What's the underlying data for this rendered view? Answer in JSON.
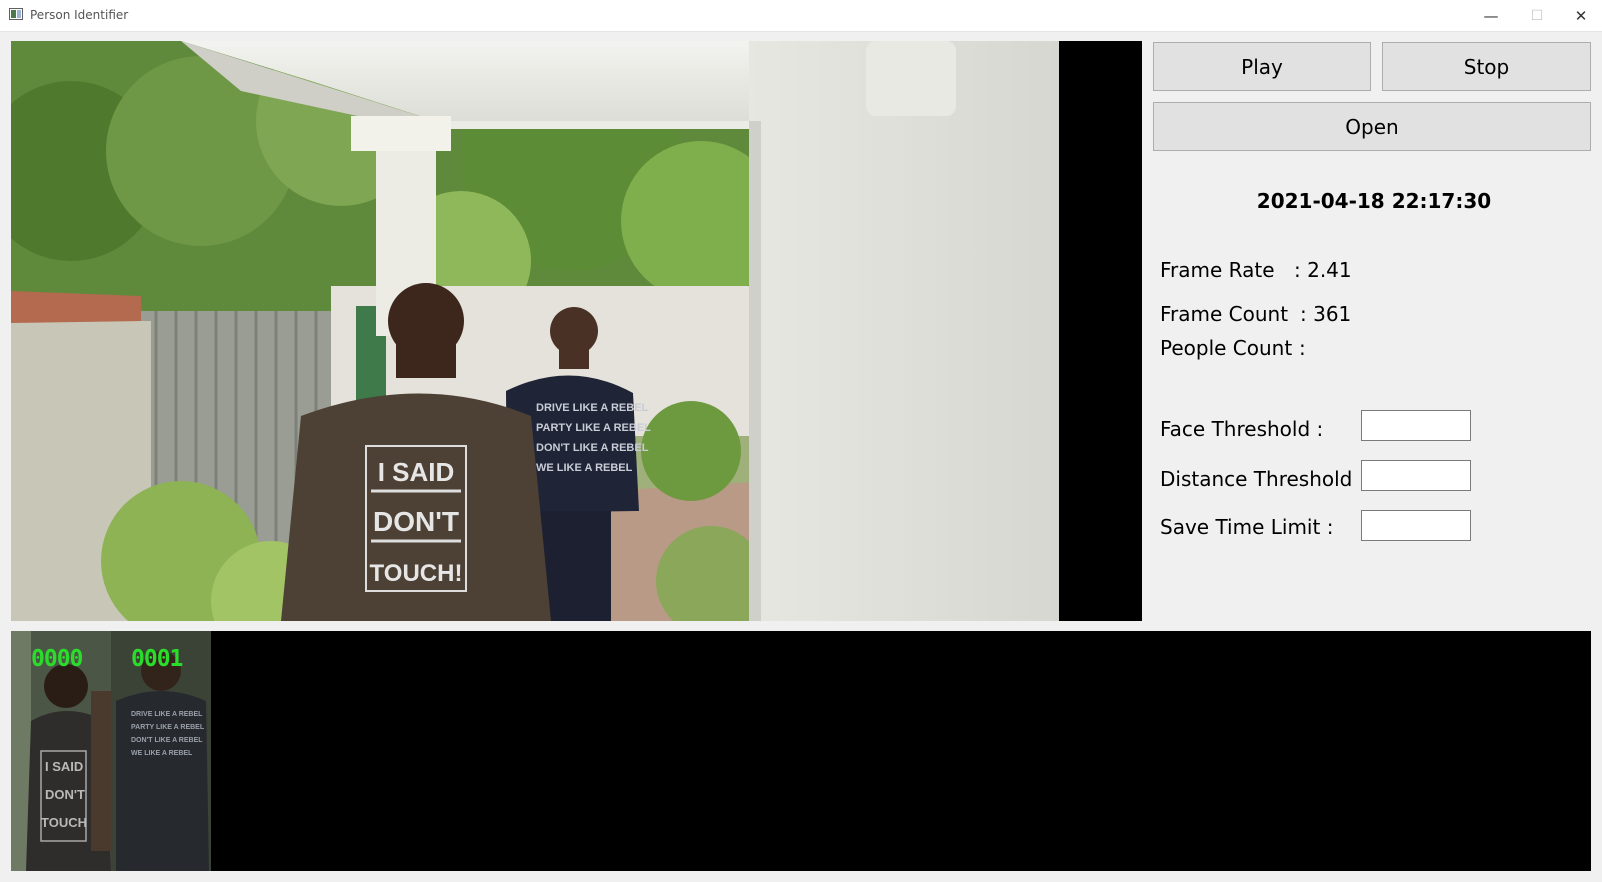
{
  "window": {
    "title": "Person Identifier",
    "minimize_glyph": "—",
    "maximize_glyph": "☐",
    "close_glyph": "✕"
  },
  "video": {
    "shirt_front": [
      "I SAID",
      "DON'T",
      "TOUCH!"
    ]
  },
  "controls": {
    "play_label": "Play",
    "stop_label": "Stop",
    "open_label": "Open"
  },
  "datetime": "2021-04-18  22:17:30",
  "stats": {
    "frame_rate_label": "Frame Rate",
    "frame_rate_value": ": 2.41",
    "frame_count_label": "Frame Count",
    "frame_count_value": ": 361",
    "people_count_label": "People Count",
    "people_count_value": ":"
  },
  "settings": {
    "face_threshold_label": "Face Threshold :",
    "face_threshold_value": "",
    "distance_threshold_label": "Distance Threshold :",
    "distance_threshold_value": "",
    "save_time_limit_label": "Save Time Limit :",
    "save_time_limit_value": ""
  },
  "gallery": {
    "ids": [
      "0000",
      "0001"
    ]
  },
  "colors": {
    "id_label": "#2bdc2b",
    "panel_bg": "#f0f0f0",
    "button_bg": "#e1e1e1"
  }
}
